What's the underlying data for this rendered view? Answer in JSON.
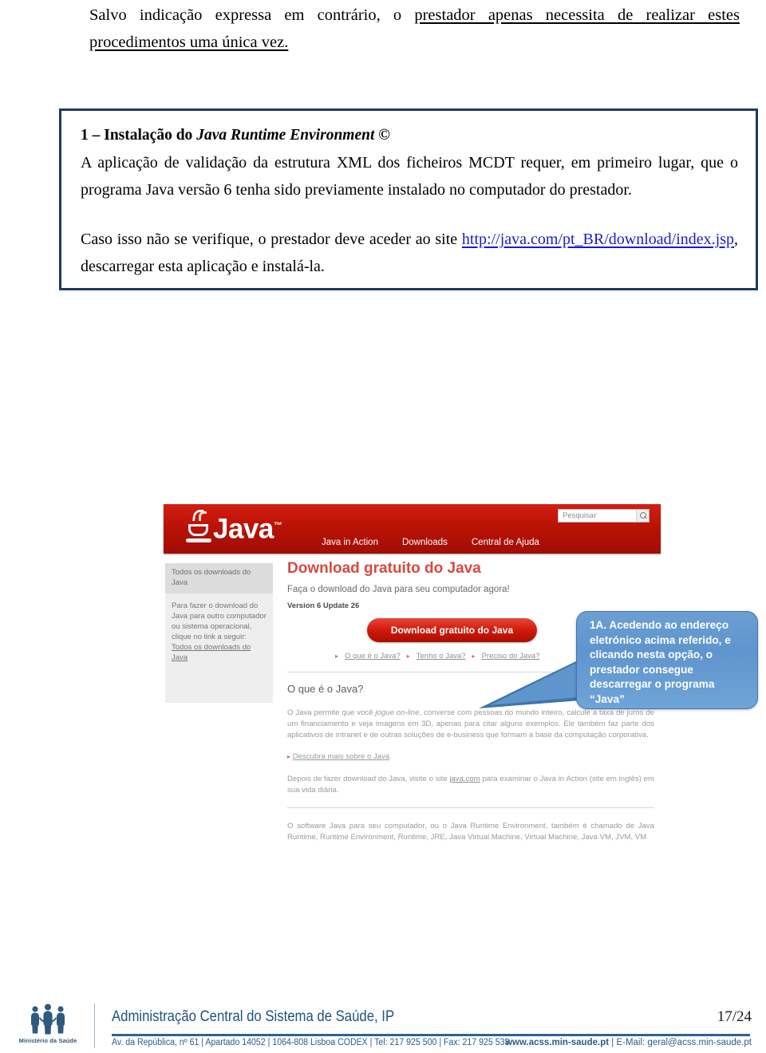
{
  "intro": {
    "plain_prefix": "Salvo indicação expressa em contrário, o ",
    "underlined": "prestador apenas necessita de realizar estes procedimentos uma única vez."
  },
  "notebox": {
    "heading_prefix": "1 – Instalação do ",
    "heading_italic": "Java Runtime Environment",
    "heading_suffix": " ©",
    "paragraph_1": "A aplicação de validação da estrutura XML dos ficheiros MCDT requer, em primeiro lugar, que o programa Java versão 6 tenha sido previamente instalado no computador do prestador.",
    "paragraph_2_prefix": "Caso isso não se verifique, o prestador deve aceder ao site ",
    "link_text": "http://java.com/pt_BR/download/index.jsp",
    "paragraph_2_suffix": ", descarregar esta aplicação e instalá-la.",
    "border_color": "#1F3864",
    "link_color": "#1a1ad0"
  },
  "java_screenshot": {
    "banner": {
      "logo_text": "Java",
      "logo_tm": "™",
      "brand_color": "#bb1206",
      "nav": [
        "Java in Action",
        "Downloads",
        "Central de Ajuda"
      ],
      "search_placeholder": "Pesquisar"
    },
    "sidebar": {
      "header": "Todos os downloads do Java",
      "text": "Para fazer o download do Java para outro computador ou sistema operacional, clique no link a seguir:",
      "link": "Todos os downloads do Java"
    },
    "main": {
      "title": "Download gratuito do Java",
      "subtitle": "Faça o download do Java para seu computador agora!",
      "version": "Version 6 Update 26",
      "download_button": "Download gratuito do Java",
      "quick_links": [
        "O que é o Java?",
        "Tenho o Java?",
        "Preciso do Java?"
      ],
      "section_title": "O que é o Java?",
      "paragraph_1_a": "O Java permite que você ",
      "paragraph_1_italic": "jogue on-line",
      "paragraph_1_b": ", converse com pessoas do mundo inteiro, calcule a taxa de juros de um financiamento e veja imagens em 3D, apenas para citar alguns exemplos. Ele também faz parte dos aplicativos de intranet e de outras soluções de e-business que formam a base da computação corporativa.",
      "discover_link": "Descubra mais sobre o Java",
      "paragraph_2_a": "Depois de fazer download do Java, visite o site ",
      "paragraph_2_link": "java.com",
      "paragraph_2_b": " para examinar o Java in Action (site em inglês) em sua vida diária.",
      "paragraph_3": "O software Java para seu computador, ou o Java Runtime Environment, também é chamado de Java Runtime, Runtime Environment, Runtime, JRE, Java Virtual Machine, Virtual Machine, Java VM, JVM, VM"
    }
  },
  "callout": {
    "text": "1A. Acedendo ao endereço eletrónico acima referido, e clicando nesta opção, o prestador consegue descarregar o programa “Java”",
    "fill_color": "#6b9fd4",
    "border_color": "#3f74ad"
  },
  "footer": {
    "logo_caption": "Ministério da Saúde",
    "organization": "Administração Central do Sistema de Saúde, IP",
    "page_number": "17/24",
    "address": "Av. da República, nº 61 | Apartado 14052 | 1064-808 Lisboa CODEX | Tel: 217 925 500 | Fax: 217 925 533",
    "website": "www.acss.min-saude.pt",
    "email_separator": " | E-Mail: ",
    "email": "geral@acss.min-saude.pt",
    "accent_color": "#2b6395"
  }
}
